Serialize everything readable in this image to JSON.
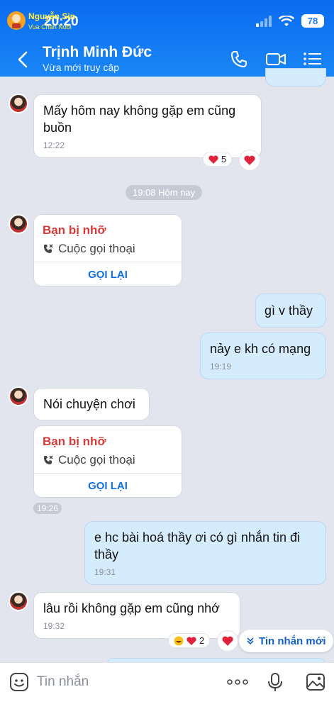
{
  "status": {
    "time": "20:20",
    "battery": "78"
  },
  "watermark": {
    "line1": "Nguyễn Sin",
    "line2": "Vua Chăn Nuôi"
  },
  "header": {
    "name": "Trịnh Minh Đức",
    "status": "Vừa mới truy cập"
  },
  "messages": {
    "m1": {
      "text": "Mấy hôm nay không gặp em cũng buồn",
      "time": "12:22",
      "reaction_count": "5"
    },
    "divider": "19:08 Hôm nay",
    "call1": {
      "title": "Bạn bị nhỡ",
      "subtitle": "Cuộc gọi thoại",
      "action": "GỌI LẠI"
    },
    "m2": {
      "text": "gì v thầy"
    },
    "m3": {
      "text": "nảy e kh có mạng",
      "time": "19:19"
    },
    "m4": {
      "text": "Nói chuyện chơi"
    },
    "call2": {
      "title": "Bạn bị nhỡ",
      "subtitle": "Cuộc gọi thoại",
      "action": "GỌI LẠI",
      "time": "19:26"
    },
    "m5": {
      "text": "e hc bài hoá thầy ơi có gì nhắn tin đi thầy",
      "time": "19:31"
    },
    "m6": {
      "text": "lâu rồi không gặp em cũng nhớ",
      "time": "19:32",
      "reaction_count": "2"
    }
  },
  "new_messages_label": "Tin nhắn mới",
  "input": {
    "placeholder": "Tin nhắn"
  },
  "colors": {
    "header": "#1a7df3",
    "outgoing": "#d5ecfd",
    "missed": "#d63b3b",
    "link": "#1170e6"
  }
}
